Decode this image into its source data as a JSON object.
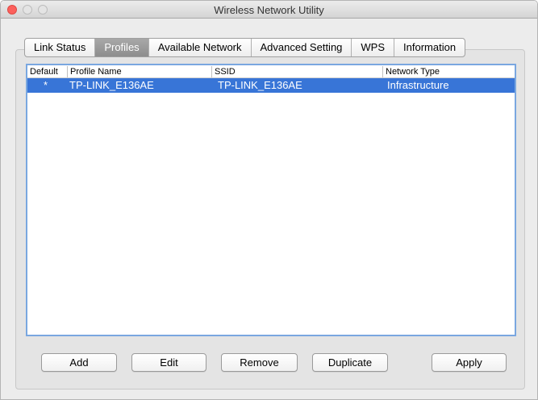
{
  "window": {
    "title": "Wireless Network Utility"
  },
  "tabs": [
    {
      "label": "Link Status",
      "active": false
    },
    {
      "label": "Profiles",
      "active": true
    },
    {
      "label": "Available Network",
      "active": false
    },
    {
      "label": "Advanced Setting",
      "active": false
    },
    {
      "label": "WPS",
      "active": false
    },
    {
      "label": "Information",
      "active": false
    }
  ],
  "table": {
    "columns": [
      "Default",
      "Profile Name",
      "SSID",
      "Network Type"
    ],
    "rows": [
      {
        "default": "*",
        "profile_name": "TP-LINK_E136AE",
        "ssid": "TP-LINK_E136AE",
        "network_type": "Infrastructure",
        "selected": true
      }
    ]
  },
  "buttons": {
    "add": "Add",
    "edit": "Edit",
    "remove": "Remove",
    "duplicate": "Duplicate",
    "apply": "Apply"
  },
  "colors": {
    "selection": "#3875d7",
    "table_border": "#7aa7e0",
    "close_button": "#fc605c"
  }
}
